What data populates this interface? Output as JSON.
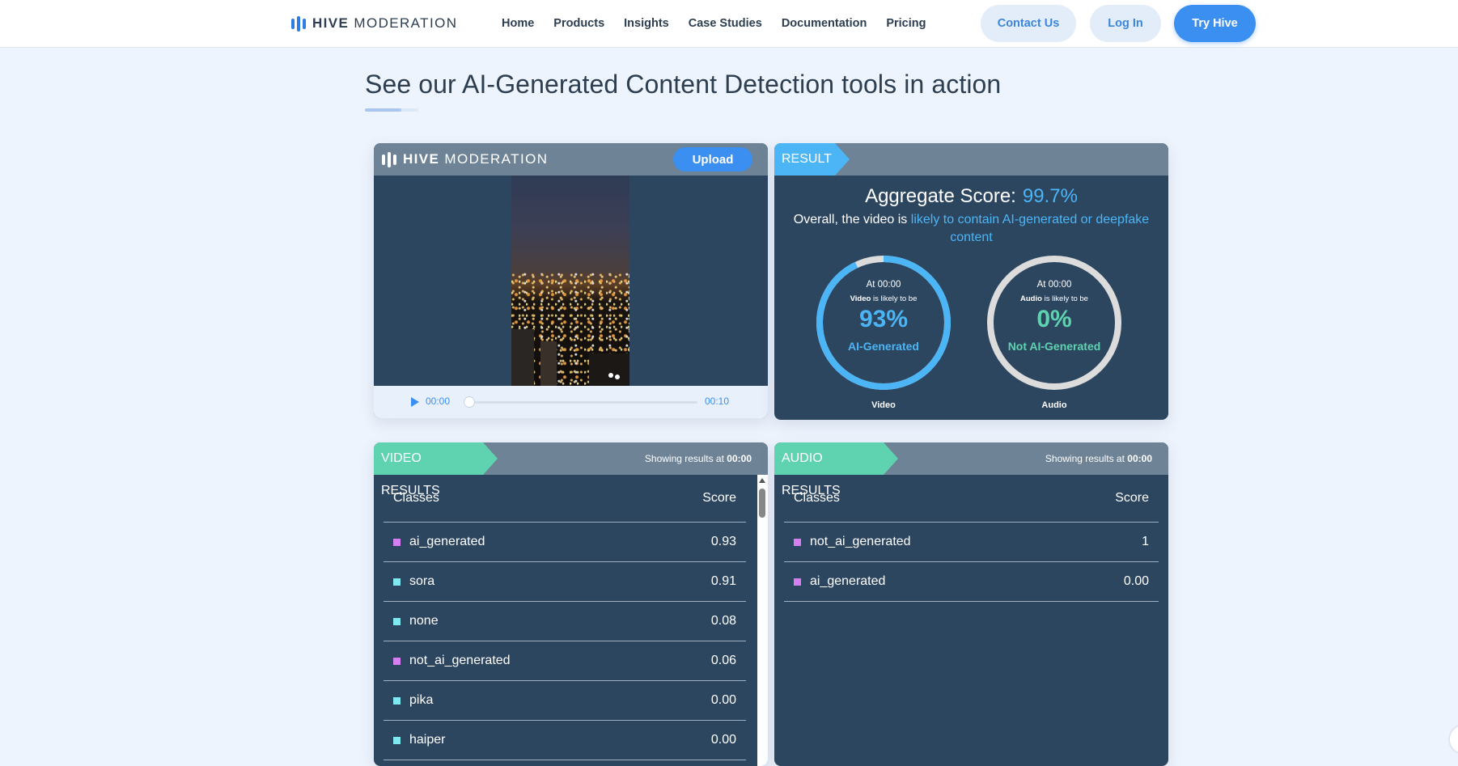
{
  "nav": {
    "logo_bold": "HIVE",
    "logo_light": "MODERATION",
    "links": [
      "Home",
      "Products",
      "Insights",
      "Case Studies",
      "Documentation",
      "Pricing"
    ],
    "contact": "Contact Us",
    "login": "Log In",
    "try": "Try Hive"
  },
  "heading": "See our AI-Generated Content Detection tools in action",
  "player": {
    "logo_bold": "HIVE",
    "logo_light": "MODERATION",
    "upload": "Upload",
    "time_current": "00:00",
    "time_end": "00:10",
    "progress_fraction": 0
  },
  "result": {
    "tag": "RESULT",
    "aggregate_label": "Aggregate Score:",
    "aggregate_value": "99.7%",
    "overall_prefix": "Overall, the video is",
    "overall_highlight": "likely to contain AI-generated or deepfake content",
    "video_ring": {
      "at": "At 00:00",
      "kind": "Video",
      "likely": "is likely to be",
      "pct": "93%",
      "label": "AI-Generated",
      "caption": "Video",
      "fraction": 0.93,
      "color": "#4cb5f5"
    },
    "audio_ring": {
      "at": "At 00:00",
      "kind": "Audio",
      "likely": "is likely to be",
      "pct": "0%",
      "label": "Not AI-Generated",
      "caption": "Audio",
      "fraction": 0,
      "color": "#5fd2b0"
    }
  },
  "video_results": {
    "tag": "VIDEO RESULTS",
    "showing_prefix": "Showing results at",
    "showing_time": "00:00",
    "col_classes": "Classes",
    "col_score": "Score",
    "rows": [
      {
        "cls": "ai_generated",
        "score": "0.93",
        "color": "#d77ff0"
      },
      {
        "cls": "sora",
        "score": "0.91",
        "color": "#7fe8f0"
      },
      {
        "cls": "none",
        "score": "0.08",
        "color": "#7fe8f0"
      },
      {
        "cls": "not_ai_generated",
        "score": "0.06",
        "color": "#d77ff0"
      },
      {
        "cls": "pika",
        "score": "0.00",
        "color": "#7fe8f0"
      },
      {
        "cls": "haiper",
        "score": "0.00",
        "color": "#7fe8f0"
      }
    ]
  },
  "audio_results": {
    "tag": "AUDIO RESULTS",
    "showing_prefix": "Showing results at",
    "showing_time": "00:00",
    "col_classes": "Classes",
    "col_score": "Score",
    "rows": [
      {
        "cls": "not_ai_generated",
        "score": "1",
        "color": "#d77ff0"
      },
      {
        "cls": "ai_generated",
        "score": "0.00",
        "color": "#d77ff0"
      }
    ]
  }
}
